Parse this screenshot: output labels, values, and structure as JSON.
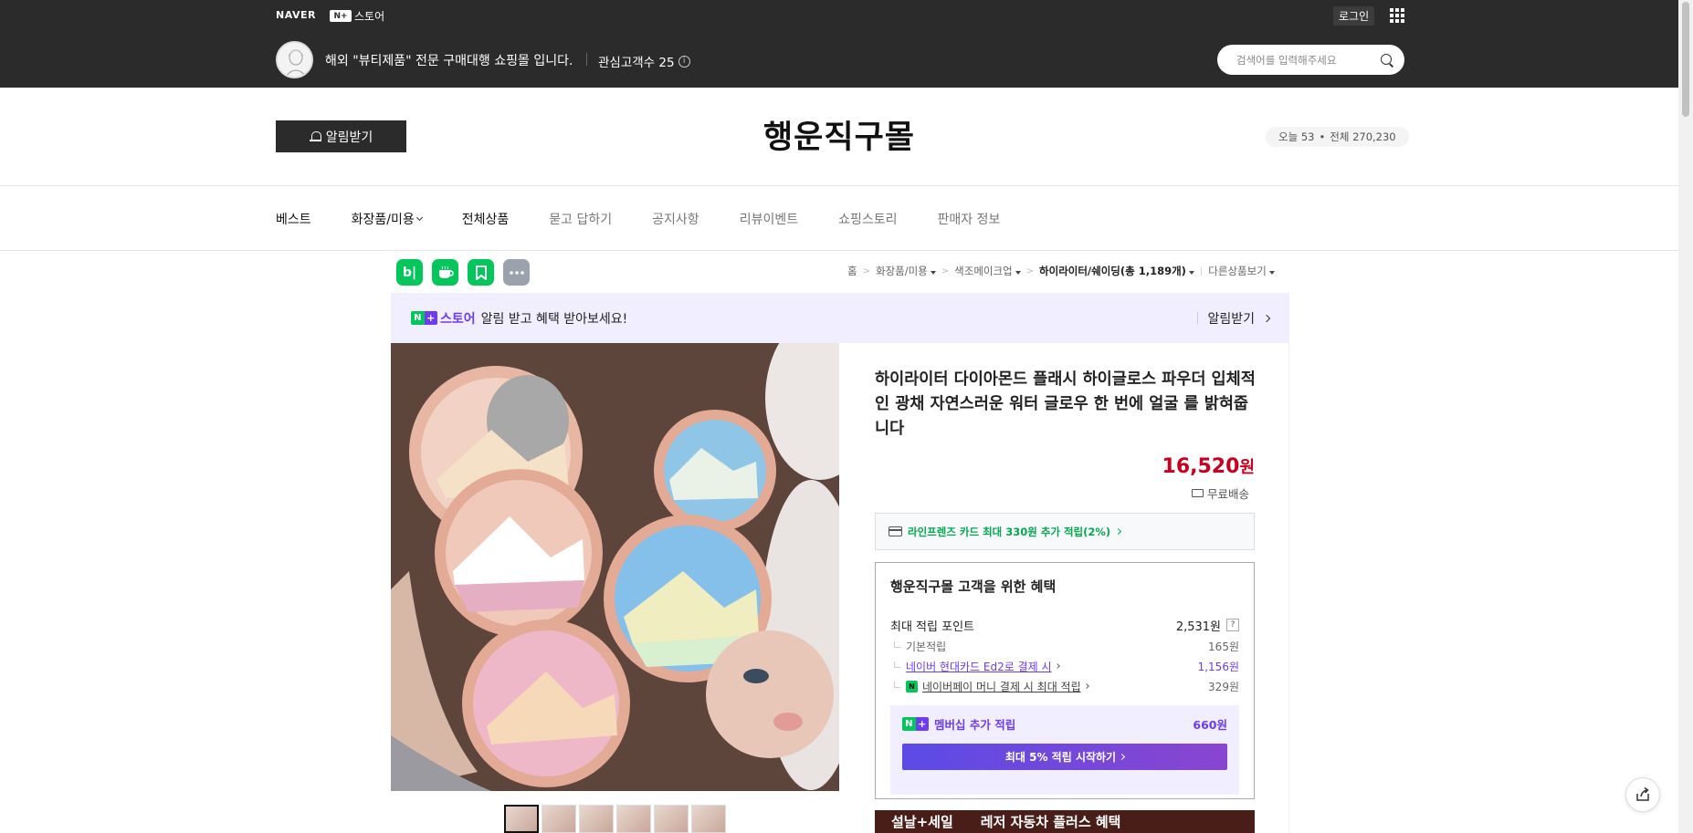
{
  "header": {
    "naver_logo": "NAVER",
    "nstore_badge": "N+",
    "nstore_label": "스토어",
    "login_label": "로그인",
    "shop_description": "해외 \"뷰티제품\" 전문 구매대행 쇼핑몰 입니다.",
    "interest_label": "관심고객수 25",
    "search_placeholder": "검색어를 입력해주세요"
  },
  "store": {
    "alarm_label": "알림받기",
    "title": "행운직구몰",
    "visitor_today": "오늘 53",
    "visitor_dot": "•",
    "visitor_total": "전체 270,230"
  },
  "nav": {
    "items": [
      {
        "label": "베스트"
      },
      {
        "label": "화장품/미용"
      },
      {
        "label": "전체상품"
      },
      {
        "label": "묻고 답하기"
      },
      {
        "label": "공지사항"
      },
      {
        "label": "리뷰이벤트"
      },
      {
        "label": "쇼핑스토리"
      },
      {
        "label": "판매자 정보"
      }
    ]
  },
  "share": {
    "blog": "b|",
    "icons": [
      "blog-icon",
      "cafe-icon",
      "bookmark-icon",
      "more-icon"
    ],
    "colors": [
      "#03c75a",
      "#03c75a",
      "#03c75a",
      "#9aa3ad"
    ]
  },
  "breadcrumb": {
    "home": "홈",
    "sep": ">",
    "cat1": "화장품/미용",
    "cat2": "색조메이크업",
    "cat3": "하이라이터/쉐이딩(총 1,189개)",
    "other": "다른상품보기"
  },
  "promo": {
    "badge_n": "N",
    "badge_plus": "+",
    "store_label": "스토어",
    "text": "알림 받고 혜택 받아보세요!",
    "action": "알림받기"
  },
  "product": {
    "title": "하이라이터 다이아몬드 플래시 하이글로스 파우더 입체적인 광채 자연스러운 워터 글로우 한 번에 얼굴 를 밝혀줍니다",
    "price": "16,520",
    "price_unit": "원",
    "shipping": "무료배송",
    "card_benefit": "라인프렌즈 카드 최대 330원 추가 적립(2%)",
    "thumb_count": 6
  },
  "benefit": {
    "title": "행운직구몰 고객을 위한 혜택",
    "max_points_label": "최대 적립 포인트",
    "max_points_value": "2,531원",
    "help": "?",
    "rows": [
      {
        "label": "기본적립",
        "value": "165원"
      },
      {
        "label": "네이버 현대카드 Ed2로 결제 시",
        "value": "1,156원"
      },
      {
        "label": "네이버페이 머니 결제 시 최대 적립",
        "value": "329원"
      }
    ],
    "npay_badge": "N",
    "member_label": "멤버십 추가 적립",
    "member_value": "660원",
    "member_btn": "최대 5% 적립 시작하기"
  },
  "banner": {
    "left": "설날+세일",
    "right": "레저 자동차 플러스 혜택"
  },
  "colors": {
    "header_bg": "#2b2b2b",
    "price_red": "#c7001f",
    "naver_green": "#03c75a",
    "membership_purple": "#6d3bf1"
  }
}
